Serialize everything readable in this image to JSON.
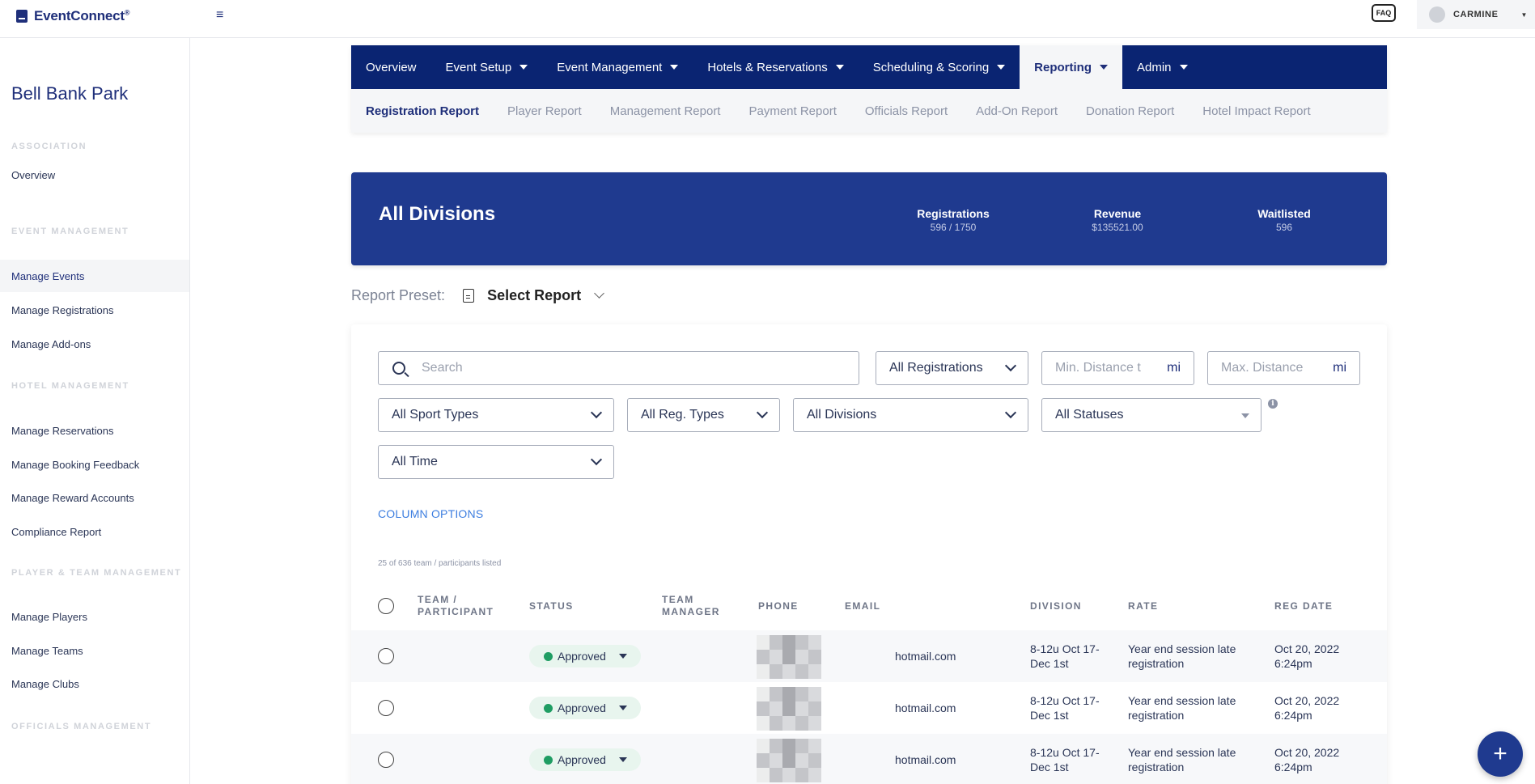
{
  "brand": {
    "name": "EventConnect",
    "tm": "®"
  },
  "header": {
    "faq_label": "FAQ",
    "username": "CARMINE"
  },
  "sidebar": {
    "org_name": "Bell Bank Park",
    "sections": [
      {
        "title": "ASSOCIATION",
        "items": [
          "Overview"
        ]
      },
      {
        "title": "EVENT MANAGEMENT",
        "items": [
          "Manage Events",
          "Manage Registrations",
          "Manage Add-ons"
        ]
      },
      {
        "title": "HOTEL MANAGEMENT",
        "items": [
          "Manage Reservations",
          "Manage Booking Feedback",
          "Manage Reward Accounts",
          "Compliance Report"
        ]
      },
      {
        "title": "PLAYER & TEAM MANAGEMENT",
        "items": [
          "Manage Players",
          "Manage Teams",
          "Manage Clubs"
        ]
      },
      {
        "title": "OFFICIALS MANAGEMENT",
        "items": []
      }
    ],
    "active_item": "Manage Events"
  },
  "nav": {
    "items": [
      "Overview",
      "Event Setup",
      "Event Management",
      "Hotels & Reservations",
      "Scheduling & Scoring",
      "Reporting",
      "Admin"
    ],
    "active": "Reporting",
    "sub_items": [
      "Registration Report",
      "Player Report",
      "Management Report",
      "Payment Report",
      "Officials Report",
      "Add-On Report",
      "Donation Report",
      "Hotel Impact Report"
    ],
    "sub_active": "Registration Report"
  },
  "banner": {
    "title": "All Divisions",
    "stats": [
      {
        "label": "Registrations",
        "value": "596 / 1750"
      },
      {
        "label": "Revenue",
        "value": "$135521.00"
      },
      {
        "label": "Waitlisted",
        "value": "596"
      }
    ]
  },
  "preset": {
    "label": "Report Preset:",
    "value": "Select Report"
  },
  "filters": {
    "search_placeholder": "Search",
    "registrations": "All Registrations",
    "min_distance_placeholder": "Min. Distance t",
    "max_distance_placeholder": "Max. Distance",
    "distance_unit": "mi",
    "sport_types": "All Sport Types",
    "reg_types": "All Reg. Types",
    "divisions": "All Divisions",
    "statuses": "All Statuses",
    "time": "All Time",
    "info": "i"
  },
  "column_options": "COLUMN OPTIONS",
  "listed_text": "25 of 636 team / participants listed",
  "table": {
    "headers": {
      "team_1": "TEAM /",
      "team_2": "PARTICIPANT",
      "status": "STATUS",
      "manager_1": "TEAM",
      "manager_2": "MANAGER",
      "phone": "PHONE",
      "email": "EMAIL",
      "division": "DIVISION",
      "rate": "RATE",
      "reg_date": "REG DATE"
    },
    "rows": [
      {
        "status": "Approved",
        "email": "hotmail.com",
        "division_1": "8-12u Oct 17-",
        "division_2": "Dec 1st",
        "rate_1": "Year end session late",
        "rate_2": "registration",
        "date_1": "Oct 20, 2022",
        "date_2": "6:24pm"
      },
      {
        "status": "Approved",
        "email": "hotmail.com",
        "division_1": "8-12u Oct 17-",
        "division_2": "Dec 1st",
        "rate_1": "Year end session late",
        "rate_2": "registration",
        "date_1": "Oct 20, 2022",
        "date_2": "6:24pm"
      },
      {
        "status": "Approved",
        "email": "hotmail.com",
        "division_1": "8-12u Oct 17-",
        "division_2": "Dec 1st",
        "rate_1": "Year end session late",
        "rate_2": "registration",
        "date_1": "Oct 20, 2022",
        "date_2": "6:24pm"
      }
    ]
  },
  "fab_label": "+",
  "colors": {
    "navy": "#0a2472",
    "banner": "#1f3a8f",
    "link": "#3d7ee0",
    "approved": "#1f9d63"
  }
}
